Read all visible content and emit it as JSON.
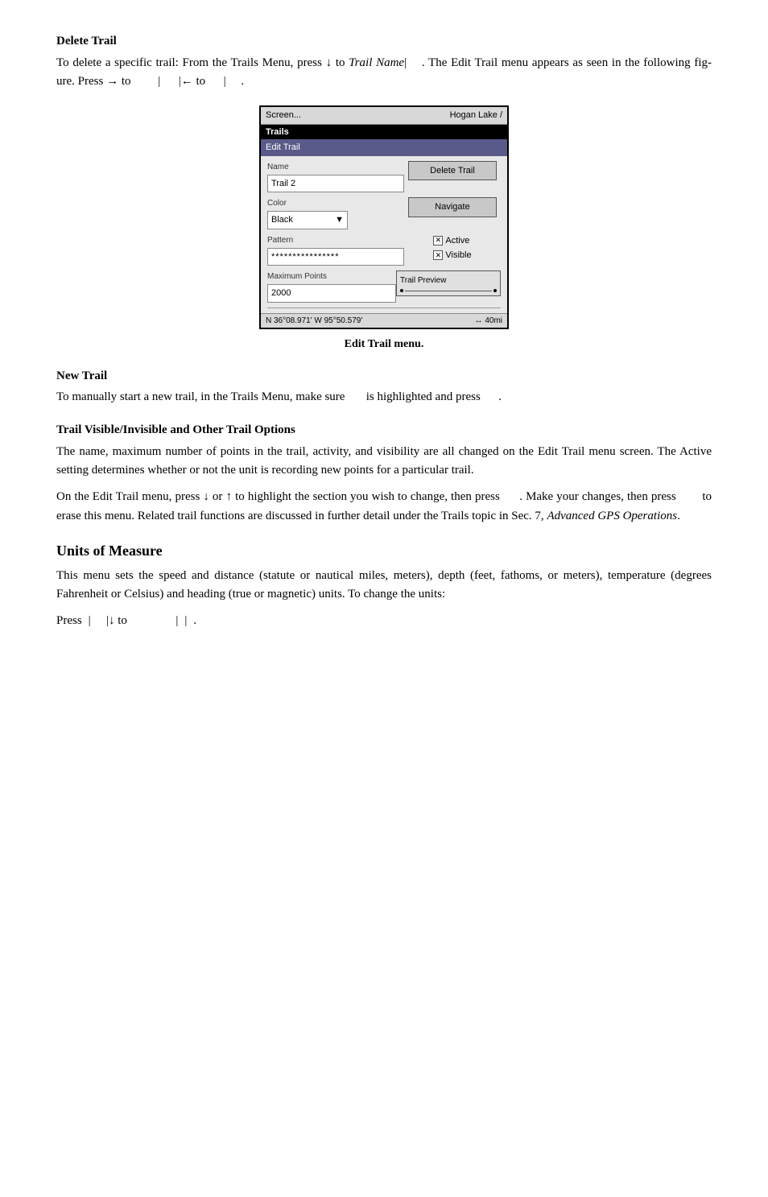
{
  "sections": {
    "delete_trail": {
      "title": "Delete Trail",
      "paragraph1_parts": [
        "To delete a specific trail: From the Trails Menu, press ",
        "↓",
        " to ",
        "Trail Name",
        "|      . The Edit Trail menu appears as seen in the following figure. Press → to",
        "      |      |← to      |      ."
      ],
      "figure_caption": "Edit Trail menu."
    },
    "new_trail": {
      "title": "New Trail",
      "paragraph": "To manually start a new trail, in the Trails Menu, make sure       is highlighted and press      ."
    },
    "trail_options": {
      "title": "Trail Visible/Invisible and Other Trail Options",
      "paragraph1": "The name, maximum number of points in the trail, activity, and visibility are all changed on the Edit Trail menu screen. The Active setting determines whether or not the unit is recording new points for a particular trail.",
      "paragraph2_parts": [
        "On the Edit Trail menu, press ↓ or ↑ to highlight the section you wish to change, then press      . Make your changes, then press       to erase this menu. Related trail functions are discussed in further detail under the Trails topic in Sec. 7, ",
        "Advanced GPS Operations",
        "."
      ]
    },
    "units_of_measure": {
      "title": "Units of Measure",
      "paragraph": "This menu sets the speed and distance (statute or nautical miles, meters), depth (feet, fathoms, or meters), temperature (degrees Fahrenheit or Celsius) and heading (true or magnetic) units. To change the units:",
      "press_line": "Press      |      |↓ to                  |      |      ."
    }
  },
  "gps_screen": {
    "header_left": "Screen...",
    "header_right": "Hogan Lake    /",
    "trails_label": "Trails",
    "edit_trail_label": "Edit Trail",
    "name_label": "Name",
    "name_value": "Trail 2",
    "delete_trail_button": "Delete Trail",
    "color_label": "Color",
    "color_value": "Black",
    "navigate_button": "Navigate",
    "pattern_label": "Pattern",
    "pattern_value": "****************",
    "active_label": "Active",
    "visible_label": "Visible",
    "max_points_label": "Maximum Points",
    "max_points_value": "2000",
    "trail_preview_label": "Trail Preview",
    "status_coords": "N  36°08.971'  W  95°50.579'",
    "status_scale": "↔  40mi"
  }
}
